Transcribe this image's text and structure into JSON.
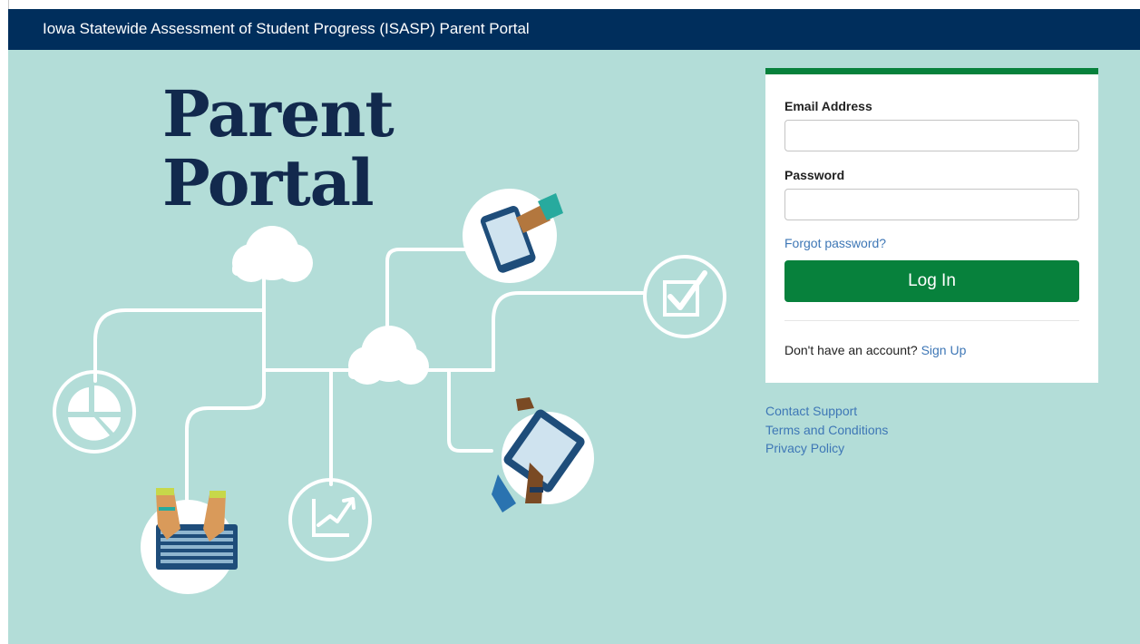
{
  "header": {
    "title": "Iowa Statewide Assessment of Student Progress (ISASP) Parent Portal"
  },
  "hero": {
    "line1": "Parent",
    "line2": "Portal"
  },
  "login": {
    "email_label": "Email Address",
    "email_value": "",
    "password_label": "Password",
    "password_value": "",
    "forgot_label": "Forgot password?",
    "login_button": "Log In",
    "signup_prompt": "Don't have an account?",
    "signup_link": "Sign Up"
  },
  "footer": {
    "links": [
      "Contact Support",
      "Terms and Conditions",
      "Privacy Policy"
    ]
  },
  "colors": {
    "header_bg": "#002e5c",
    "hero_bg": "#b3ddd8",
    "accent_green": "#07813c",
    "link_blue": "#3e77b6",
    "title_navy": "#12294d"
  },
  "icons": [
    "cloud-icon",
    "phone-hand-icon",
    "checkbox-icon",
    "pie-chart-icon",
    "tablet-hand-icon",
    "growth-chart-icon",
    "laptop-hands-icon"
  ]
}
